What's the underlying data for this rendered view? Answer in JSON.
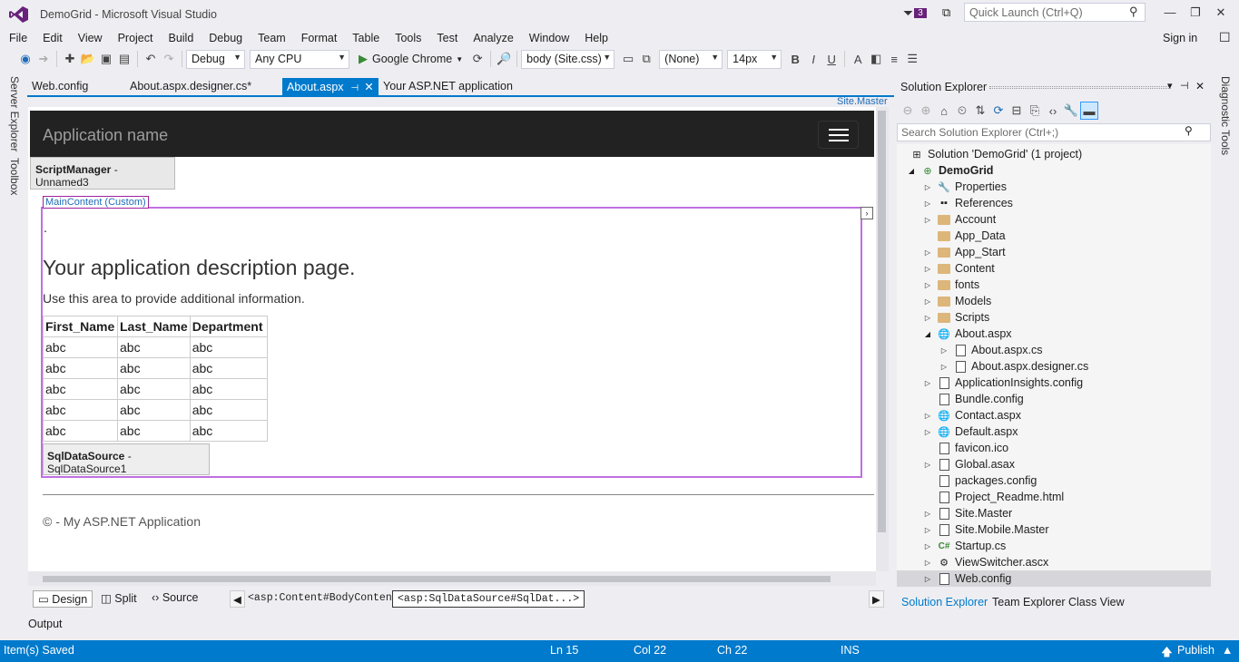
{
  "window": {
    "title": "DemoGrid - Microsoft Visual Studio",
    "notification_count": "3",
    "quick_launch_placeholder": "Quick Launch (Ctrl+Q)",
    "sign_in": "Sign in"
  },
  "menu": [
    "File",
    "Edit",
    "View",
    "Project",
    "Build",
    "Debug",
    "Team",
    "Format",
    "Table",
    "Tools",
    "Test",
    "Analyze",
    "Window",
    "Help"
  ],
  "toolbar": {
    "config": "Debug",
    "platform": "Any CPU",
    "browser": "Google Chrome",
    "css_target": "body (Site.css)",
    "style": "(None)",
    "font_size": "14px",
    "bold": "B",
    "italic": "I",
    "underline": "U",
    "font_color": "A"
  },
  "side_left": {
    "server_explorer": "Server Explorer",
    "toolbox": "Toolbox"
  },
  "side_right": {
    "diagnostic_tools": "Diagnostic Tools"
  },
  "tabs": [
    {
      "label": "Web.config"
    },
    {
      "label": "About.aspx.designer.cs*"
    },
    {
      "label": "About.aspx"
    },
    {
      "label": "Your ASP.NET application"
    }
  ],
  "site_master": "Site.Master",
  "designer": {
    "app_name": "Application name",
    "script_manager_type": "ScriptManager",
    "script_manager_name": " - Unnamed3",
    "main_content_label": "MainContent (Custom)",
    "bullet": ".",
    "heading": "Your application description page.",
    "paragraph": "Use this area to provide additional information.",
    "grid": {
      "columns": [
        "First_Name",
        "Last_Name",
        "Department"
      ],
      "rows": [
        [
          "abc",
          "abc",
          "abc"
        ],
        [
          "abc",
          "abc",
          "abc"
        ],
        [
          "abc",
          "abc",
          "abc"
        ],
        [
          "abc",
          "abc",
          "abc"
        ],
        [
          "abc",
          "abc",
          "abc"
        ]
      ]
    },
    "sql_source_type": "SqlDataSource",
    "sql_source_name": " - SqlDataSource1",
    "footer": "© - My ASP.NET Application"
  },
  "view_tabs": {
    "design": "Design",
    "split": "Split",
    "source": "Source",
    "crumb1": "<asp:Content#BodyContent>",
    "crumb2": "<asp:SqlDataSource#SqlDat...>"
  },
  "output_label": "Output",
  "status": {
    "message": "Item(s) Saved",
    "ln": "Ln 15",
    "col": "Col 22",
    "ch": "Ch 22",
    "mode": "INS",
    "publish": "Publish"
  },
  "solution_explorer": {
    "title": "Solution Explorer",
    "search_placeholder": "Search Solution Explorer (Ctrl+;)",
    "nodes": [
      {
        "label": "Solution 'DemoGrid' (1 project)",
        "icon": "solution-icon"
      },
      {
        "label": "DemoGrid",
        "icon": "web-project-icon"
      },
      {
        "label": "Properties",
        "icon": "wrench-icon"
      },
      {
        "label": "References",
        "icon": "references-icon"
      },
      {
        "label": "Account",
        "icon": "folder-icon"
      },
      {
        "label": "App_Data",
        "icon": "folder-icon"
      },
      {
        "label": "App_Start",
        "icon": "folder-icon"
      },
      {
        "label": "Content",
        "icon": "folder-icon"
      },
      {
        "label": "fonts",
        "icon": "folder-icon"
      },
      {
        "label": "Models",
        "icon": "folder-icon"
      },
      {
        "label": "Scripts",
        "icon": "folder-icon"
      },
      {
        "label": "About.aspx",
        "icon": "aspx-icon"
      },
      {
        "label": "About.aspx.cs",
        "icon": "cs-file-icon"
      },
      {
        "label": "About.aspx.designer.cs",
        "icon": "cs-file-icon"
      },
      {
        "label": "ApplicationInsights.config",
        "icon": "config-icon"
      },
      {
        "label": "Bundle.config",
        "icon": "config-icon"
      },
      {
        "label": "Contact.aspx",
        "icon": "aspx-icon"
      },
      {
        "label": "Default.aspx",
        "icon": "aspx-icon"
      },
      {
        "label": "favicon.ico",
        "icon": "ico-file-icon"
      },
      {
        "label": "Global.asax",
        "icon": "asax-icon"
      },
      {
        "label": "packages.config",
        "icon": "config-icon"
      },
      {
        "label": "Project_Readme.html",
        "icon": "html-file-icon"
      },
      {
        "label": "Site.Master",
        "icon": "master-icon"
      },
      {
        "label": "Site.Mobile.Master",
        "icon": "master-icon"
      },
      {
        "label": "Startup.cs",
        "icon": "csharp-icon"
      },
      {
        "label": "ViewSwitcher.ascx",
        "icon": "ascx-icon"
      },
      {
        "label": "Web.config",
        "icon": "config-icon"
      }
    ],
    "bottom_tabs": [
      "Solution Explorer",
      "Team Explorer",
      "Class View"
    ]
  }
}
